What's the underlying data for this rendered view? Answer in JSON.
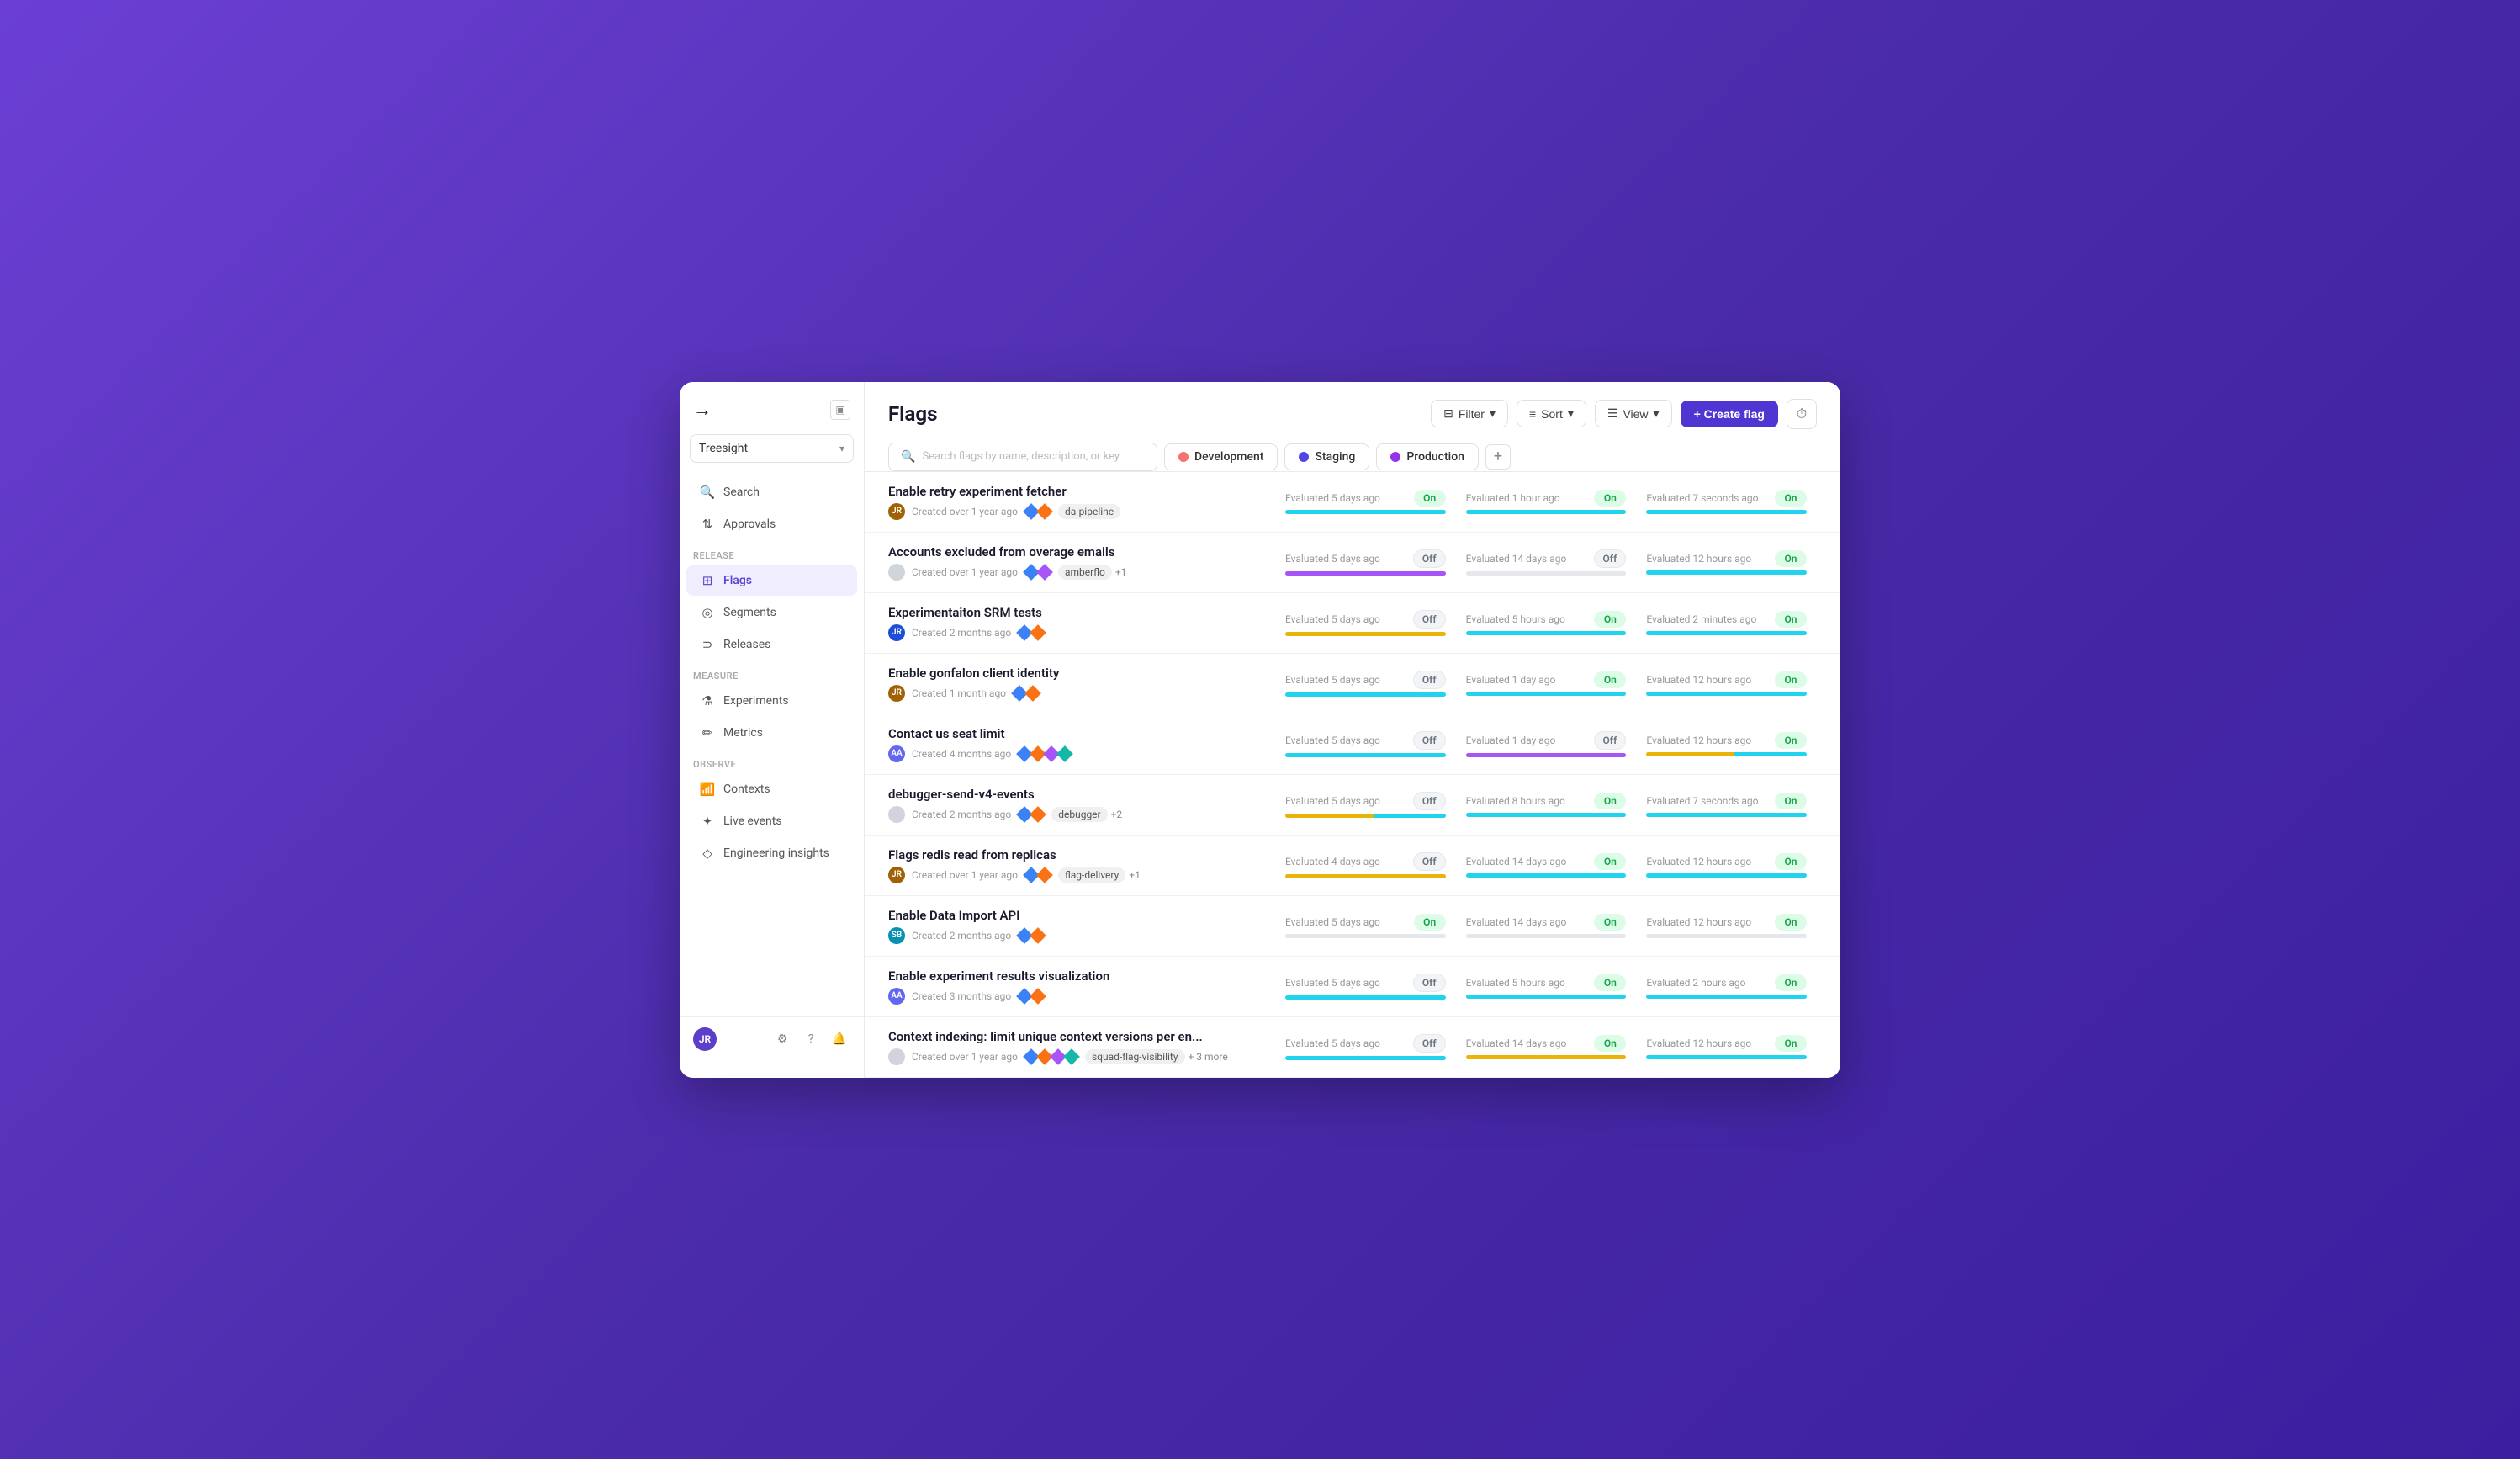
{
  "app": {
    "logo_arrow": "→",
    "collapse_icon": "▣",
    "workspace": "Treesight",
    "workspace_chevron": "▾"
  },
  "sidebar": {
    "search_label": "Search",
    "approvals_label": "Approvals",
    "release_section": "Release",
    "flags_label": "Flags",
    "segments_label": "Segments",
    "releases_label": "Releases",
    "measure_section": "Measure",
    "experiments_label": "Experiments",
    "metrics_label": "Metrics",
    "observe_section": "Observe",
    "contexts_label": "Contexts",
    "live_events_label": "Live events",
    "engineering_insights_label": "Engineering insights",
    "user_initials": "JR"
  },
  "header": {
    "title": "Flags",
    "filter_label": "Filter",
    "sort_label": "Sort",
    "view_label": "View",
    "create_label": "+ Create flag"
  },
  "search": {
    "placeholder": "Search flags by name, description, or key"
  },
  "environments": [
    {
      "name": "Development",
      "dot_class": "dev"
    },
    {
      "name": "Staging",
      "dot_class": "staging"
    },
    {
      "name": "Production",
      "dot_class": "prod"
    }
  ],
  "flags": [
    {
      "name": "Enable retry experiment fetcher",
      "created": "Created over 1 year ago",
      "tags": [
        "da-pipeline"
      ],
      "extra_tags": null,
      "avatar_color": "#a16207",
      "avatar_initials": "JR",
      "diamonds": [
        "blue",
        "orange"
      ],
      "dev": {
        "eval": "Evaluated 5 days ago",
        "status": "On",
        "bar": "bar-teal"
      },
      "staging": {
        "eval": "Evaluated 1 hour ago",
        "status": "On",
        "bar": "bar-teal"
      },
      "prod": {
        "eval": "Evaluated 7 seconds ago",
        "status": "On",
        "bar": "bar-teal"
      }
    },
    {
      "name": "Accounts excluded from overage emails",
      "created": "Created over 1 year ago",
      "tags": [
        "amberflo"
      ],
      "extra_tags": "+1",
      "avatar_color": null,
      "avatar_initials": null,
      "diamonds": [
        "blue",
        "purple"
      ],
      "dev": {
        "eval": "Evaluated 5 days ago",
        "status": "Off",
        "bar": "bar-purple"
      },
      "staging": {
        "eval": "Evaluated 14 days ago",
        "status": "Off",
        "bar": "bar-gray"
      },
      "prod": {
        "eval": "Evaluated 12 hours ago",
        "status": "On",
        "bar": "bar-teal"
      }
    },
    {
      "name": "Experimentaiton SRM tests",
      "created": "Created 2 months ago",
      "tags": [],
      "extra_tags": null,
      "avatar_color": "#1d4ed8",
      "avatar_initials": "JR",
      "diamonds": [
        "blue",
        "orange"
      ],
      "dev": {
        "eval": "Evaluated 5 days ago",
        "status": "Off",
        "bar": "bar-yellow"
      },
      "staging": {
        "eval": "Evaluated 5 hours ago",
        "status": "On",
        "bar": "bar-teal"
      },
      "prod": {
        "eval": "Evaluated 2 minutes ago",
        "status": "On",
        "bar": "bar-teal"
      }
    },
    {
      "name": "Enable gonfalon client identity",
      "created": "Created 1 month ago",
      "tags": [],
      "extra_tags": null,
      "avatar_color": "#a16207",
      "avatar_initials": "JR",
      "diamonds": [
        "blue",
        "orange"
      ],
      "dev": {
        "eval": "Evaluated 5 days ago",
        "status": "Off",
        "bar": "bar-teal"
      },
      "staging": {
        "eval": "Evaluated 1 day ago",
        "status": "On",
        "bar": "bar-teal"
      },
      "prod": {
        "eval": "Evaluated 12 hours ago",
        "status": "On",
        "bar": "bar-teal"
      }
    },
    {
      "name": "Contact us seat limit",
      "created": "Created 4 months ago",
      "tags": [],
      "extra_tags": null,
      "avatar_color": "#6366f1",
      "avatar_initials": "AA",
      "diamonds": [
        "blue",
        "orange",
        "purple",
        "teal"
      ],
      "dev": {
        "eval": "Evaluated 5 days ago",
        "status": "Off",
        "bar": "bar-teal"
      },
      "staging": {
        "eval": "Evaluated 1 day ago",
        "status": "Off",
        "bar": "bar-purple"
      },
      "prod": {
        "eval": "Evaluated 12 hours ago",
        "status": "On",
        "bar": "bar-mixed"
      }
    },
    {
      "name": "debugger-send-v4-events",
      "created": "Created 2 months ago",
      "tags": [
        "debugger"
      ],
      "extra_tags": "+2",
      "avatar_color": null,
      "avatar_initials": null,
      "diamonds": [
        "blue",
        "orange"
      ],
      "dev": {
        "eval": "Evaluated 5 days ago",
        "status": "Off",
        "bar": "bar-mixed"
      },
      "staging": {
        "eval": "Evaluated 8 hours ago",
        "status": "On",
        "bar": "bar-teal"
      },
      "prod": {
        "eval": "Evaluated 7 seconds ago",
        "status": "On",
        "bar": "bar-teal"
      }
    },
    {
      "name": "Flags redis read from replicas",
      "created": "Created over 1 year ago",
      "tags": [
        "flag-delivery"
      ],
      "extra_tags": "+1",
      "avatar_color": "#a16207",
      "avatar_initials": "JR",
      "diamonds": [
        "blue",
        "orange"
      ],
      "dev": {
        "eval": "Evaluated 4 days ago",
        "status": "Off",
        "bar": "bar-yellow"
      },
      "staging": {
        "eval": "Evaluated 14 days ago",
        "status": "On",
        "bar": "bar-teal"
      },
      "prod": {
        "eval": "Evaluated 12 hours ago",
        "status": "On",
        "bar": "bar-teal"
      }
    },
    {
      "name": "Enable Data Import API",
      "created": "Created 2 months ago",
      "tags": [],
      "extra_tags": null,
      "avatar_color": "#0891b2",
      "avatar_initials": "SB",
      "diamonds": [
        "blue",
        "orange"
      ],
      "dev": {
        "eval": "Evaluated 5 days ago",
        "status": "On",
        "bar": "bar-gray"
      },
      "staging": {
        "eval": "Evaluated 14 days ago",
        "status": "On",
        "bar": "bar-gray"
      },
      "prod": {
        "eval": "Evaluated 12 hours ago",
        "status": "On",
        "bar": "bar-gray"
      }
    },
    {
      "name": "Enable experiment results visualization",
      "created": "Created 3 months ago",
      "tags": [],
      "extra_tags": null,
      "avatar_color": "#6366f1",
      "avatar_initials": "AA",
      "diamonds": [
        "blue",
        "orange"
      ],
      "dev": {
        "eval": "Evaluated 5 days ago",
        "status": "Off",
        "bar": "bar-teal"
      },
      "staging": {
        "eval": "Evaluated 5 hours ago",
        "status": "On",
        "bar": "bar-teal"
      },
      "prod": {
        "eval": "Evaluated 2 hours ago",
        "status": "On",
        "bar": "bar-teal"
      }
    },
    {
      "name": "Context indexing: limit unique context versions per en...",
      "created": "Created over 1 year ago",
      "tags": [
        "squad-flag-visibility"
      ],
      "extra_tags": "+ 3 more",
      "avatar_color": null,
      "avatar_initials": null,
      "diamonds": [
        "blue",
        "orange",
        "purple",
        "teal"
      ],
      "dev": {
        "eval": "Evaluated 5 days ago",
        "status": "Off",
        "bar": "bar-teal"
      },
      "staging": {
        "eval": "Evaluated 14 days ago",
        "status": "On",
        "bar": "bar-yellow"
      },
      "prod": {
        "eval": "Evaluated 12 hours ago",
        "status": "On",
        "bar": "bar-teal"
      }
    }
  ]
}
